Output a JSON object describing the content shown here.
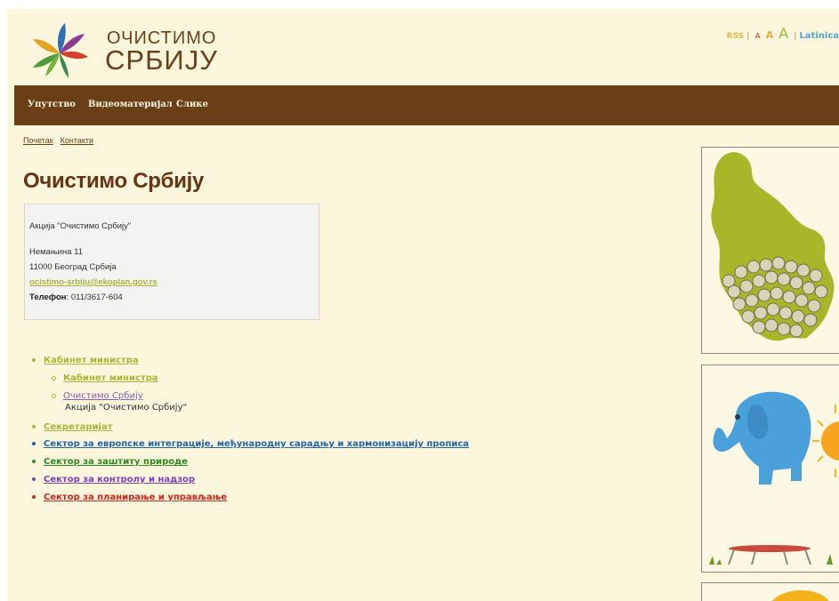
{
  "header": {
    "logo_line1": "ОЧИСТИМО",
    "logo_line2": "СРБИЈУ",
    "toplinks": {
      "rss": "RSS",
      "sep1": "|",
      "a_small": "A",
      "a_medium": "A",
      "a_large": "A",
      "sep2": "|",
      "latinica": "Latinica"
    }
  },
  "nav": {
    "items": [
      "Упутство",
      "Видеоматеријал",
      "Слике"
    ]
  },
  "breadcrumb": [
    "Почетак",
    "Контакти"
  ],
  "page_title": "Очистимо Србију",
  "contact": {
    "org": "Акција \"Очистимо Србију\"",
    "street": "Немањина 11",
    "city": "11000 Београд Србија",
    "email": "ocistimo-srbiju@ekoplan.gov.rs",
    "phone_label": "Телефон",
    "phone_value": ": 011/3617-604"
  },
  "tree": {
    "cabinet": "Кабинет министра",
    "cabinet_sub": "Кабинет министра",
    "cleanup": "Очистимо Србију",
    "cleanup_desc": "Акција \"Очистимо Србију\"",
    "secretariat": "Секретаријат",
    "eu": "Сектор за европске интеграције, међународну сарадњу и хармонизацију прописа",
    "nature": "Сектор за заштиту природе",
    "control": "Сектор за контролу и надзор",
    "planning": "Сектор за планирање и управљање"
  },
  "colors": {
    "brown": "#6a3f18",
    "green": "#a8b63a",
    "purple": "#7a4fb5",
    "blue": "#2465a8",
    "darkgreen": "#2f8a22",
    "violet": "#7d3fb8",
    "red": "#c8281e"
  },
  "icons": [
    "logo-leaves-icon",
    "serbia-map-icon",
    "elephant-icon",
    "sun-icon",
    "trampoline-icon"
  ]
}
